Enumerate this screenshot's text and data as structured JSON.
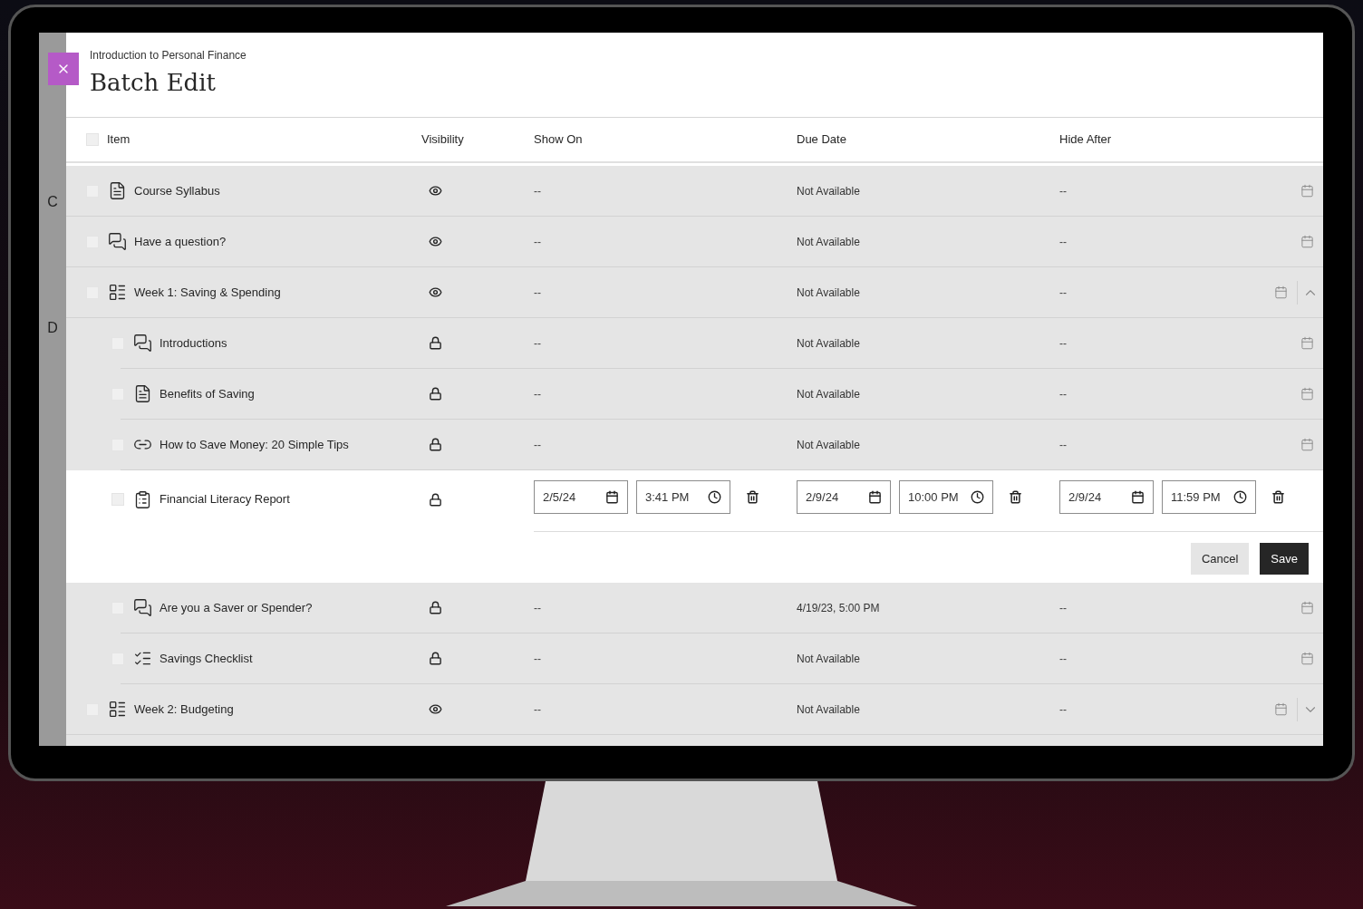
{
  "course": "Introduction to Personal Finance",
  "title": "Batch Edit",
  "sidebar": {
    "letters": [
      "C",
      "D"
    ]
  },
  "select_all": {
    "checked": false
  },
  "columns": [
    "Item",
    "Visibility",
    "Show On",
    "Due Date",
    "Hide After"
  ],
  "items": [
    {
      "kind": "document",
      "name": "Course Syllabus",
      "visible": true,
      "show_on": "--",
      "due_date": "Not Available",
      "hide_after": "--",
      "checked": false
    },
    {
      "kind": "discussion",
      "name": "Have a question?",
      "visible": true,
      "show_on": "--",
      "due_date": "Not Available",
      "hide_after": "--",
      "checked": false
    },
    {
      "kind": "folder",
      "name": "Week 1: Saving & Spending",
      "visible": true,
      "show_on": "--",
      "due_date": "Not Available",
      "hide_after": "--",
      "checked": false,
      "expanded": true,
      "children": [
        {
          "kind": "discussion",
          "name": "Introductions",
          "visible": false,
          "show_on": "--",
          "due_date": "Not Available",
          "hide_after": "--",
          "checked": false
        },
        {
          "kind": "document",
          "name": "Benefits of Saving",
          "visible": false,
          "show_on": "--",
          "due_date": "Not Available",
          "hide_after": "--",
          "checked": false
        },
        {
          "kind": "link",
          "name": "How to Save Money: 20 Simple Tips",
          "visible": false,
          "show_on": "--",
          "due_date": "Not Available",
          "hide_after": "--",
          "checked": false
        },
        {
          "kind": "assignment",
          "name": "Financial Literacy Report",
          "visible": false,
          "checked": false,
          "edit": {
            "show_on": {
              "date": "2/5/24",
              "time": "3:41 PM"
            },
            "due_date": {
              "date": "2/9/24",
              "time": "10:00 PM"
            },
            "hide_after": {
              "date": "2/9/24",
              "time": "11:59 PM"
            },
            "buttons": [
              "Cancel",
              "Save"
            ]
          }
        },
        {
          "kind": "discussion",
          "name": "Are you a Saver or Spender?",
          "visible": false,
          "show_on": "--",
          "due_date": "4/19/23, 5:00 PM",
          "hide_after": "--",
          "checked": false
        },
        {
          "kind": "checklist",
          "name": "Savings Checklist",
          "visible": false,
          "show_on": "--",
          "due_date": "Not Available",
          "hide_after": "--",
          "checked": false
        }
      ]
    },
    {
      "kind": "folder",
      "name": "Week 2: Budgeting",
      "visible": true,
      "show_on": "--",
      "due_date": "Not Available",
      "hide_after": "--",
      "checked": false,
      "expanded": false
    }
  ]
}
